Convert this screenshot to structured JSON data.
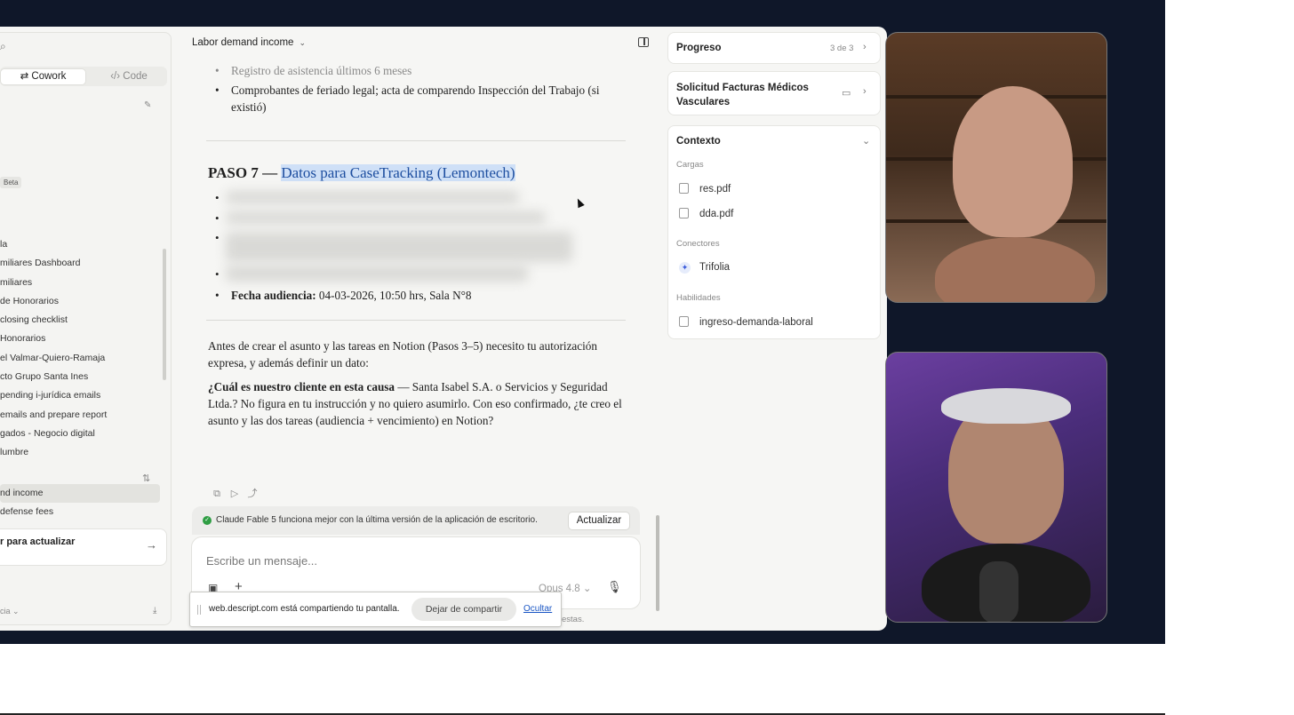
{
  "window": {
    "chat_title": "Labor demand income"
  },
  "sidebar": {
    "mode_tabs": [
      {
        "label": "Cowork",
        "icon": "cowork-icon"
      },
      {
        "label": "Code",
        "icon": "code-icon"
      }
    ],
    "beta_badge": "Beta",
    "items": [
      "la",
      "miliares Dashboard",
      "miliares",
      "de Honorarios",
      "closing checklist",
      "Honorarios",
      "el Valmar-Quiero-Ramaja",
      "cto Grupo Santa Ines",
      "pending i-jurídica emails",
      "emails and prepare report",
      "gados - Negocio digital",
      "lumbre"
    ],
    "recents": [
      "nd income",
      "defense fees"
    ],
    "update_card": {
      "label": "r para actualizar"
    },
    "bottom_label": "cia"
  },
  "message": {
    "top_bullets": [
      "Registro de asistencia últimos 6 meses",
      "Comprobantes de feriado legal; acta de comparendo Inspección del Trabajo (si existió)"
    ],
    "heading_prefix": "PASO 7 — ",
    "heading_highlight": "Datos para CaseTracking (Lemontech)",
    "fecha_label": "Fecha audiencia:",
    "fecha_value": " 04-03-2026, 10:50 hrs, Sala N°8",
    "para1": "Antes de crear el asunto y las tareas en Notion (Pasos 3–5) necesito tu autorización expresa, y además definir un dato:",
    "para2_bold": "¿Cuál es nuestro cliente en esta causa",
    "para2_rest": " — Santa Isabel S.A. o Servicios y Seguridad Ltda.? No figura en tu instrucción y no quiero asumirlo. Con eso confirmado, ¿te creo el asunto y las dos tareas (audiencia + vencimiento) en Notion?"
  },
  "banner": {
    "text": "Claude Fable 5 funciona mejor con la última versión de la aplicación de escritorio.",
    "button": "Actualizar"
  },
  "composer": {
    "placeholder": "Escribe un mensaje...",
    "model": "Opus 4.8"
  },
  "share_bar": {
    "text": "web.descript.com está compartiendo tu pantalla.",
    "stop": "Dejar de compartir",
    "hide": "Ocultar"
  },
  "footnote": "estas.",
  "right_panel": {
    "progress": {
      "title": "Progreso",
      "count": "3 de 3"
    },
    "task": {
      "title": "Solicitud Facturas Médicos Vasculares"
    },
    "context": {
      "title": "Contexto",
      "uploads_label": "Cargas",
      "files": [
        "res.pdf",
        "dda.pdf"
      ],
      "connectors_label": "Conectores",
      "connectors": [
        "Trifolia"
      ],
      "skills_label": "Habilidades",
      "skills": [
        "ingreso-demanda-laboral"
      ]
    }
  }
}
